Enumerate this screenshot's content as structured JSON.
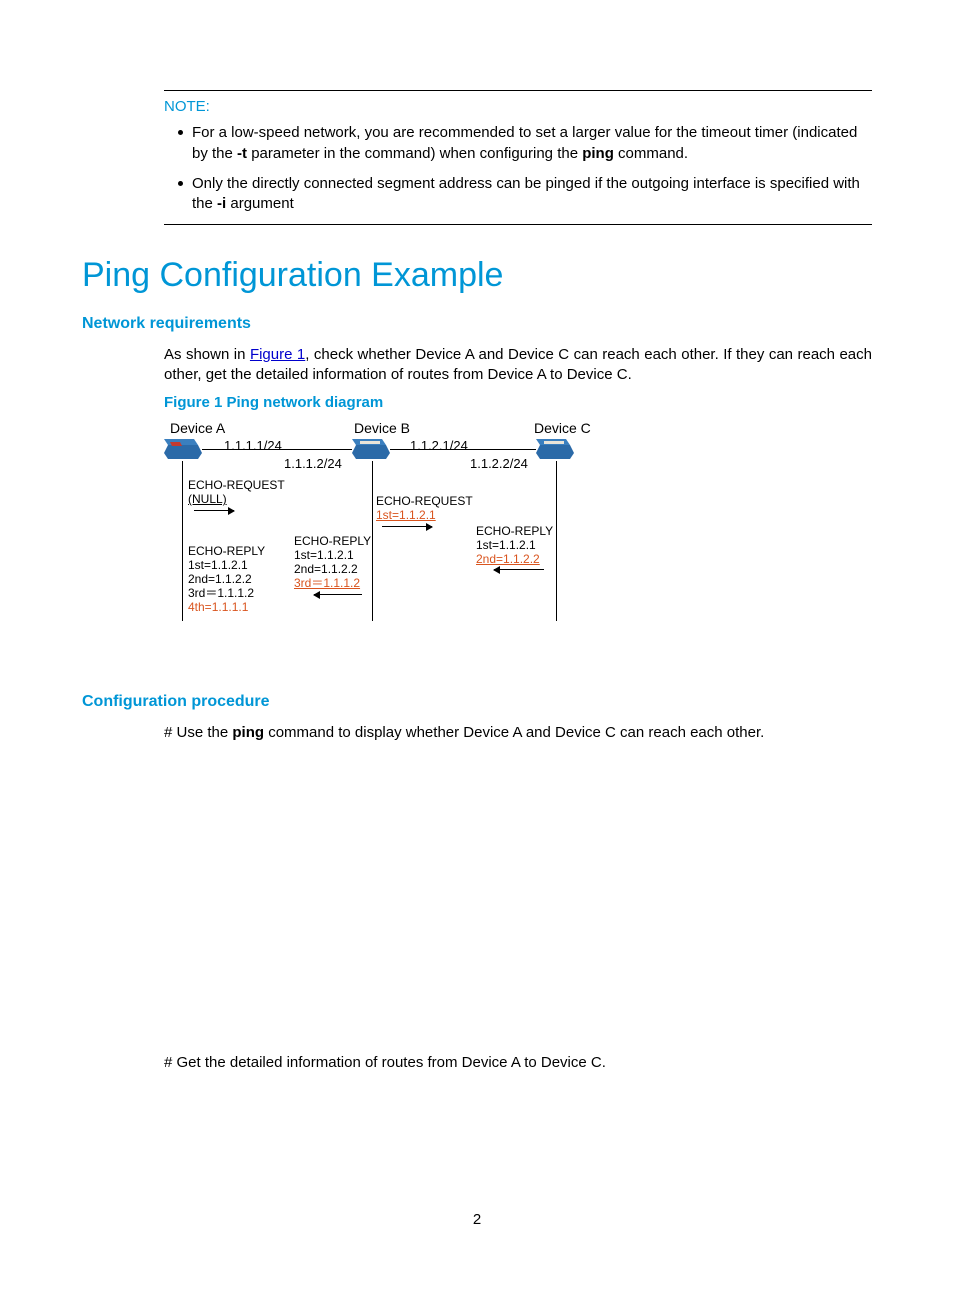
{
  "note": {
    "title": "NOTE:",
    "items": [
      {
        "pre": "For a low-speed network, you are recommended to set a larger value for the timeout timer (indicated by the ",
        "b1": "-t",
        "mid": " parameter in the command) when configuring the ",
        "b2": "ping",
        "post": " command."
      },
      {
        "pre": "Only the directly connected segment address can be pinged if the outgoing interface is specified with the ",
        "b1": "-i",
        "mid": " argument",
        "b2": "",
        "post": ""
      }
    ]
  },
  "section_title": "Ping Configuration Example",
  "netreq": {
    "heading": "Network requirements",
    "p_pre": "As shown in ",
    "p_link": "Figure 1",
    "p_post": ", check whether Device A and Device C can reach each other. If they can reach each other, get the detailed information of routes from Device A to Device C."
  },
  "figure": {
    "caption": "Figure 1 Ping network diagram",
    "devA": "Device A",
    "devB": "Device B",
    "devC": "Device C",
    "ip_a_right": "1.1.1.1/24",
    "ip_b_left": "1.1.1.2/24",
    "ip_b_right": "1.1.2.1/24",
    "ip_c_left": "1.1.2.2/24",
    "req_a": {
      "l1": "ECHO-REQUEST",
      "l2": "(NULL)"
    },
    "req_b": {
      "l1": "ECHO-REQUEST",
      "l2": "1st=1.1.2.1"
    },
    "rep_c": {
      "l1": "ECHO-REPLY",
      "l2": "1st=1.1.2.1",
      "l3": "2nd=1.1.2.2"
    },
    "rep_b": {
      "l1": "ECHO-REPLY",
      "l2": "1st=1.1.2.1",
      "l3": "2nd=1.1.2.2",
      "l4": "3rd＝1.1.1.2"
    },
    "rep_a": {
      "l1": "ECHO-REPLY",
      "l2": "1st=1.1.2.1",
      "l3": "2nd=1.1.2.2",
      "l4": "3rd＝1.1.1.2",
      "l5": "4th=1.1.1.1"
    }
  },
  "cfg": {
    "heading": "Configuration procedure",
    "p1_pre": "# Use the ",
    "p1_b": "ping",
    "p1_post": " command to display whether Device A and Device C can reach each other.",
    "p2": "# Get the detailed information of routes from Device A to Device C."
  },
  "page_number": "2"
}
